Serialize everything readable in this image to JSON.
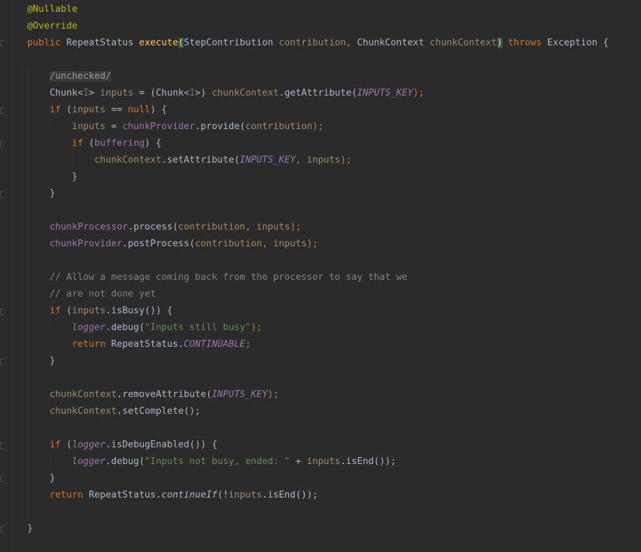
{
  "editor": {
    "lines": [
      [
        {
          "t": "@Nullable",
          "c": "ann"
        }
      ],
      [
        {
          "t": "@Override",
          "c": "ann"
        }
      ],
      [
        {
          "t": "public ",
          "c": "kw"
        },
        {
          "t": "RepeatStatus ",
          "c": ""
        },
        {
          "t": "execute",
          "c": "fn"
        },
        {
          "t": "(",
          "c": "brace-hl"
        },
        {
          "t": "StepContribution ",
          "c": ""
        },
        {
          "t": "contribution",
          "c": "param"
        },
        {
          "t": ", ",
          "c": "punc"
        },
        {
          "t": "ChunkContext ",
          "c": ""
        },
        {
          "t": "chunkContext",
          "c": "param"
        },
        {
          "t": ")",
          "c": "brace-hl"
        },
        {
          "t": " throws ",
          "c": "kw"
        },
        {
          "t": "Exception {",
          "c": ""
        }
      ],
      [],
      [
        {
          "t": "    ",
          "c": ""
        },
        {
          "t": "/unchecked/",
          "c": "unchecked"
        }
      ],
      [
        {
          "t": "    Chunk",
          "c": ""
        },
        {
          "t": "<",
          "c": ""
        },
        {
          "t": "I",
          "c": "tp"
        },
        {
          "t": "> ",
          "c": ""
        },
        {
          "t": "inputs",
          "c": "param"
        },
        {
          "t": " = (Chunk<",
          "c": ""
        },
        {
          "t": "I",
          "c": "tp"
        },
        {
          "t": ">) ",
          "c": ""
        },
        {
          "t": "chunkContext",
          "c": "param"
        },
        {
          "t": ".getAttribute(",
          "c": ""
        },
        {
          "t": "INPUTS_KEY",
          "c": "static"
        },
        {
          "t": ");",
          "c": "punc"
        }
      ],
      [
        {
          "t": "    ",
          "c": ""
        },
        {
          "t": "if",
          "c": "kw"
        },
        {
          "t": " (",
          "c": ""
        },
        {
          "t": "inputs",
          "c": "param"
        },
        {
          "t": " == ",
          "c": ""
        },
        {
          "t": "null",
          "c": "kw"
        },
        {
          "t": ") {",
          "c": ""
        }
      ],
      [
        {
          "t": "        ",
          "c": ""
        },
        {
          "t": "inputs",
          "c": "param"
        },
        {
          "t": " = ",
          "c": ""
        },
        {
          "t": "chunkProvider",
          "c": "field"
        },
        {
          "t": ".provide(",
          "c": ""
        },
        {
          "t": "contribution",
          "c": "param"
        },
        {
          "t": ");",
          "c": "punc"
        }
      ],
      [
        {
          "t": "        ",
          "c": ""
        },
        {
          "t": "if",
          "c": "kw"
        },
        {
          "t": " (",
          "c": ""
        },
        {
          "t": "buffering",
          "c": "field"
        },
        {
          "t": ") {",
          "c": ""
        }
      ],
      [
        {
          "t": "            ",
          "c": ""
        },
        {
          "t": "chunkContext",
          "c": "param"
        },
        {
          "t": ".setAttribute(",
          "c": ""
        },
        {
          "t": "INPUTS_KEY",
          "c": "static"
        },
        {
          "t": ", ",
          "c": "punc"
        },
        {
          "t": "inputs",
          "c": "param"
        },
        {
          "t": ");",
          "c": "punc"
        }
      ],
      [
        {
          "t": "        }",
          "c": ""
        }
      ],
      [
        {
          "t": "    }",
          "c": ""
        }
      ],
      [],
      [
        {
          "t": "    ",
          "c": ""
        },
        {
          "t": "chunkProcessor",
          "c": "field"
        },
        {
          "t": ".process(",
          "c": ""
        },
        {
          "t": "contribution",
          "c": "param"
        },
        {
          "t": ", ",
          "c": "punc"
        },
        {
          "t": "inputs",
          "c": "param"
        },
        {
          "t": ");",
          "c": "punc"
        }
      ],
      [
        {
          "t": "    ",
          "c": ""
        },
        {
          "t": "chunkProvider",
          "c": "field"
        },
        {
          "t": ".postProcess(",
          "c": ""
        },
        {
          "t": "contribution",
          "c": "param"
        },
        {
          "t": ", ",
          "c": "punc"
        },
        {
          "t": "inputs",
          "c": "param"
        },
        {
          "t": ");",
          "c": "punc"
        }
      ],
      [],
      [
        {
          "t": "    // Allow a message coming back from the processor to say that we",
          "c": "cmt"
        }
      ],
      [
        {
          "t": "    // are not done yet",
          "c": "cmt"
        }
      ],
      [
        {
          "t": "    ",
          "c": ""
        },
        {
          "t": "if",
          "c": "kw"
        },
        {
          "t": " (",
          "c": ""
        },
        {
          "t": "inputs",
          "c": "param"
        },
        {
          "t": ".isBusy()) {",
          "c": ""
        }
      ],
      [
        {
          "t": "        ",
          "c": ""
        },
        {
          "t": "logger",
          "c": "field ital"
        },
        {
          "t": ".debug(",
          "c": ""
        },
        {
          "t": "\"Inputs still busy\"",
          "c": "str"
        },
        {
          "t": ");",
          "c": "punc"
        }
      ],
      [
        {
          "t": "        ",
          "c": ""
        },
        {
          "t": "return ",
          "c": "kw"
        },
        {
          "t": "RepeatStatus.",
          "c": ""
        },
        {
          "t": "CONTINUABLE",
          "c": "static"
        },
        {
          "t": ";",
          "c": "punc"
        }
      ],
      [
        {
          "t": "    }",
          "c": ""
        }
      ],
      [],
      [
        {
          "t": "    ",
          "c": ""
        },
        {
          "t": "chunkContext",
          "c": "param"
        },
        {
          "t": ".removeAttribute(",
          "c": ""
        },
        {
          "t": "INPUTS_KEY",
          "c": "static"
        },
        {
          "t": ");",
          "c": "punc"
        }
      ],
      [
        {
          "t": "    ",
          "c": ""
        },
        {
          "t": "chunkContext",
          "c": "param"
        },
        {
          "t": ".setComplete();",
          "c": ""
        }
      ],
      [],
      [
        {
          "t": "    ",
          "c": ""
        },
        {
          "t": "if",
          "c": "kw"
        },
        {
          "t": " (",
          "c": ""
        },
        {
          "t": "logger",
          "c": "field ital"
        },
        {
          "t": ".isDebugEnabled()) {",
          "c": ""
        }
      ],
      [
        {
          "t": "        ",
          "c": ""
        },
        {
          "t": "logger",
          "c": "field ital"
        },
        {
          "t": ".debug(",
          "c": ""
        },
        {
          "t": "\"Inputs not busy, ended: \"",
          "c": "str"
        },
        {
          "t": " + ",
          "c": ""
        },
        {
          "t": "inputs",
          "c": "param"
        },
        {
          "t": ".isEnd());",
          "c": ""
        }
      ],
      [
        {
          "t": "    }",
          "c": ""
        }
      ],
      [
        {
          "t": "    ",
          "c": ""
        },
        {
          "t": "return ",
          "c": "kw"
        },
        {
          "t": "RepeatStatus.",
          "c": ""
        },
        {
          "t": "continueIf",
          "c": "ital"
        },
        {
          "t": "(!",
          "c": ""
        },
        {
          "t": "inputs",
          "c": "param"
        },
        {
          "t": ".isEnd());",
          "c": ""
        }
      ],
      [],
      [
        {
          "t": "}",
          "c": ""
        }
      ]
    ]
  }
}
